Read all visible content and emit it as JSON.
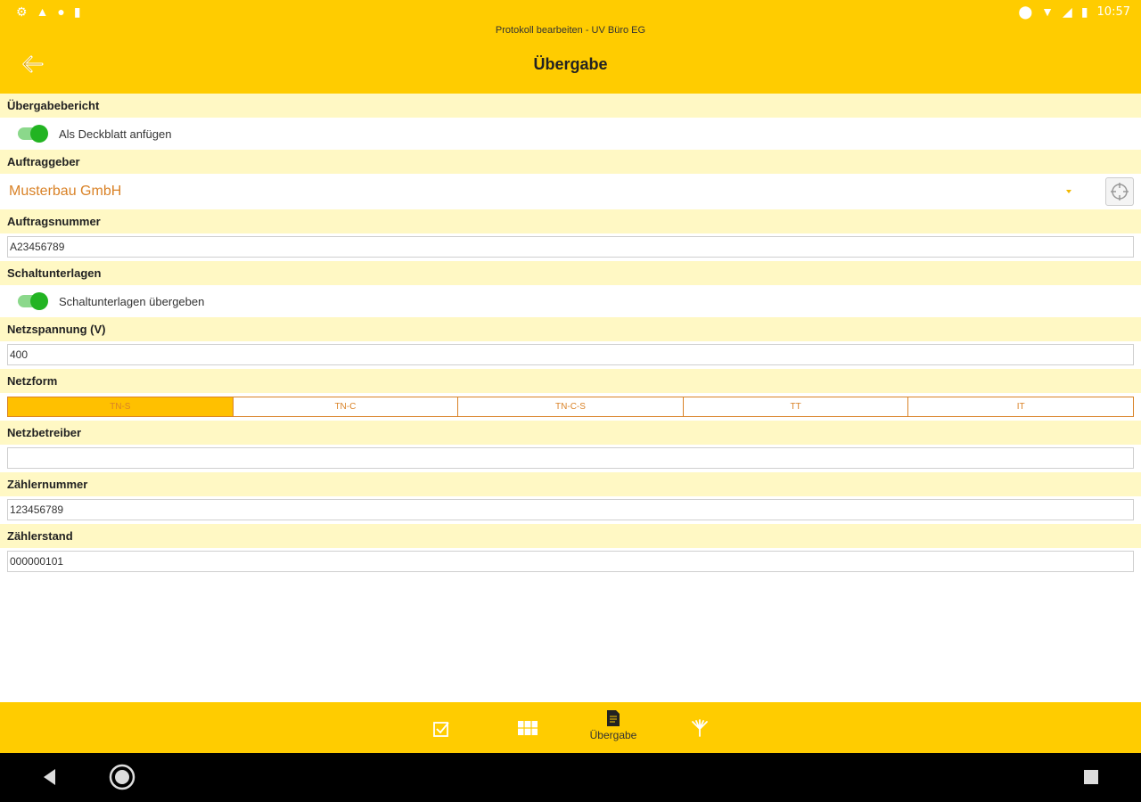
{
  "statusbar": {
    "time": "10:57"
  },
  "appbar": {
    "subtitle": "Protokoll bearbeiten - UV Büro EG",
    "title": "Übergabe"
  },
  "form": {
    "uebergabebericht": {
      "header": "Übergabebericht",
      "toggle_label": "Als Deckblatt anfügen",
      "on": true
    },
    "auftraggeber": {
      "header": "Auftraggeber",
      "value": "Musterbau GmbH"
    },
    "auftragsnummer": {
      "header": "Auftragsnummer",
      "value": "A23456789"
    },
    "schaltunterlagen": {
      "header": "Schaltunterlagen",
      "toggle_label": "Schaltunterlagen übergeben",
      "on": true
    },
    "netzspannung": {
      "header": "Netzspannung (V)",
      "value": "400"
    },
    "netzform": {
      "header": "Netzform",
      "options": [
        "TN-S",
        "TN-C",
        "TN-C-S",
        "TT",
        "IT"
      ],
      "selected": "TN-S"
    },
    "netzbetreiber": {
      "header": "Netzbetreiber",
      "value": ""
    },
    "zaehlernummer": {
      "header": "Zählernummer",
      "value": "123456789"
    },
    "zaehlerstand": {
      "header": "Zählerstand",
      "value": "000000101"
    }
  },
  "bottom_nav": {
    "active_label": "Übergabe"
  },
  "colors": {
    "accent": "#FFCC00",
    "section_bg": "#FFF8C4",
    "orange_text": "#D98227",
    "toggle_on": "#22B422"
  }
}
